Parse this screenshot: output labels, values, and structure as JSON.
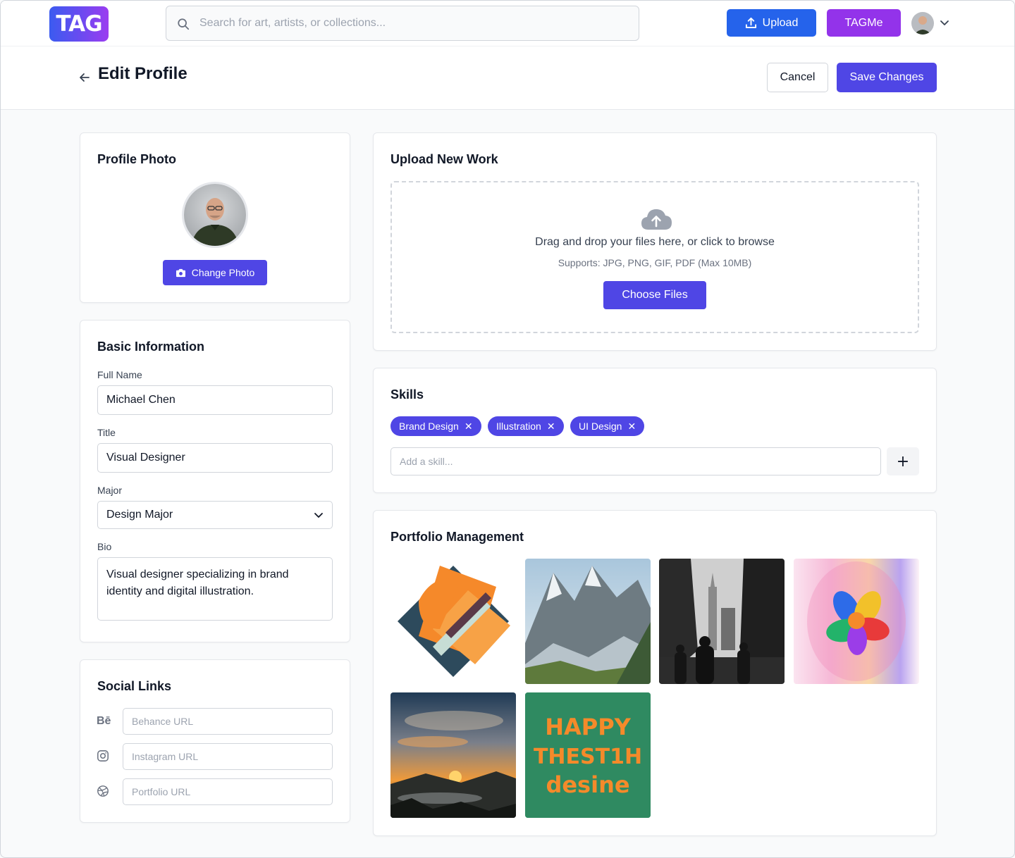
{
  "nav": {
    "logo_text": "TAG",
    "search_placeholder": "Search for art, artists, or collections...",
    "upload_label": "Upload",
    "tagme_label": "TAGMe"
  },
  "header": {
    "title": "Edit Profile",
    "cancel_label": "Cancel",
    "save_label": "Save Changes"
  },
  "profile_photo": {
    "title": "Profile Photo",
    "change_label": "Change Photo"
  },
  "basic_info": {
    "title": "Basic Information",
    "full_name_label": "Full Name",
    "full_name_value": "Michael Chen",
    "title_label": "Title",
    "title_value": "Visual Designer",
    "major_label": "Major",
    "major_value": "Design Major",
    "bio_label": "Bio",
    "bio_value": "Visual designer specializing in brand identity and digital illustration."
  },
  "social": {
    "title": "Social Links",
    "behance_icon": "Bē",
    "behance_placeholder": "Behance URL",
    "instagram_placeholder": "Instagram URL",
    "portfolio_placeholder": "Portfolio URL"
  },
  "upload": {
    "title": "Upload New Work",
    "drop_text": "Drag and drop your files here, or click to browse",
    "supports_text": "Supports: JPG, PNG, GIF, PDF (Max 10MB)",
    "choose_label": "Choose Files"
  },
  "skills": {
    "title": "Skills",
    "chips": [
      "Brand Design",
      "Illustration",
      "UI Design"
    ],
    "add_placeholder": "Add a skill...",
    "add_button": "+"
  },
  "portfolio": {
    "title": "Portfolio Management",
    "poster_lines": [
      "HAPPY",
      "THEST1H",
      "desine"
    ]
  },
  "colors": {
    "primary": "#4f46e5",
    "upload_blue": "#2563eb",
    "tagme_purple": "#9333ea"
  }
}
